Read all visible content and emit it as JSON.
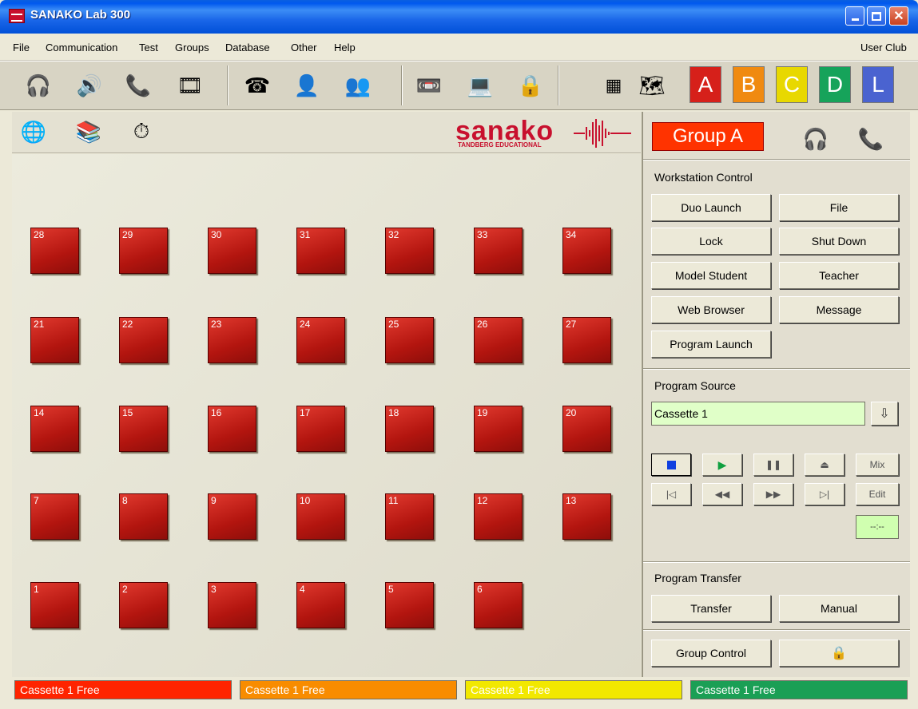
{
  "window": {
    "title": "SANAKO Lab 300",
    "controls": [
      "minimize",
      "maximize",
      "close"
    ]
  },
  "menu": {
    "items": [
      "File",
      "Communication",
      "Test",
      "Groups",
      "Database",
      "Other",
      "Help"
    ],
    "right": "User Club"
  },
  "toolbar": {
    "icons": [
      "headphones-icon",
      "speaker-icon",
      "intercom-phone-icon",
      "filmstrip-icon",
      "telephone-icon",
      "single-person-icon",
      "group-people-icon",
      "tape-deck-icon",
      "pc-network-icon",
      "padlock-icon",
      "grid-keypad-icon",
      "seating-plan-icon"
    ],
    "groups": [
      {
        "label": "A",
        "color": "#D6201A"
      },
      {
        "label": "B",
        "color": "#F08A10"
      },
      {
        "label": "C",
        "color": "#E8D800"
      },
      {
        "label": "D",
        "color": "#16A35A"
      },
      {
        "label": "L",
        "color": "#4A63D0"
      }
    ]
  },
  "secondary_toolbar": {
    "icons": [
      "globe-computer-icon",
      "stack-icon",
      "timer-computer-icon"
    ]
  },
  "logo": {
    "brand": "sanako",
    "subtitle": "TANDBERG EDUCATIONAL"
  },
  "seats": {
    "rows": [
      [
        "28",
        "29",
        "30",
        "31",
        "32",
        "33",
        "34"
      ],
      [
        "21",
        "22",
        "23",
        "24",
        "25",
        "26",
        "27"
      ],
      [
        "14",
        "15",
        "16",
        "17",
        "18",
        "19",
        "20"
      ],
      [
        "7",
        "8",
        "9",
        "10",
        "11",
        "12",
        "13"
      ],
      [
        "1",
        "2",
        "3",
        "4",
        "5",
        "6"
      ]
    ]
  },
  "panel": {
    "group_label": "Group A",
    "workstation_control": {
      "title": "Workstation Control",
      "buttons": [
        "Duo Launch",
        "File",
        "Lock",
        "Shut Down",
        "Model Student",
        "Teacher",
        "Web Browser",
        "Message",
        "Program Launch"
      ]
    },
    "program_source": {
      "title": "Program Source",
      "value": "Cassette 1",
      "transport": [
        "stop",
        "play",
        "pause",
        "eject",
        "Mix",
        "prev",
        "rewind",
        "fast-forward",
        "next",
        "Edit"
      ],
      "mix_label": "Mix",
      "edit_label": "Edit",
      "time": "--:--"
    },
    "program_transfer": {
      "title": "Program Transfer",
      "transfer": "Transfer",
      "manual": "Manual"
    },
    "group_control": "Group Control"
  },
  "status": [
    {
      "text": "Cassette 1  Free",
      "color": "#FF2400"
    },
    {
      "text": "Cassette 1  Free",
      "color": "#F88C00"
    },
    {
      "text": "Cassette 1  Free",
      "color": "#F2E800"
    },
    {
      "text": "Cassette 1 Free",
      "color": "#1A9F55"
    }
  ]
}
